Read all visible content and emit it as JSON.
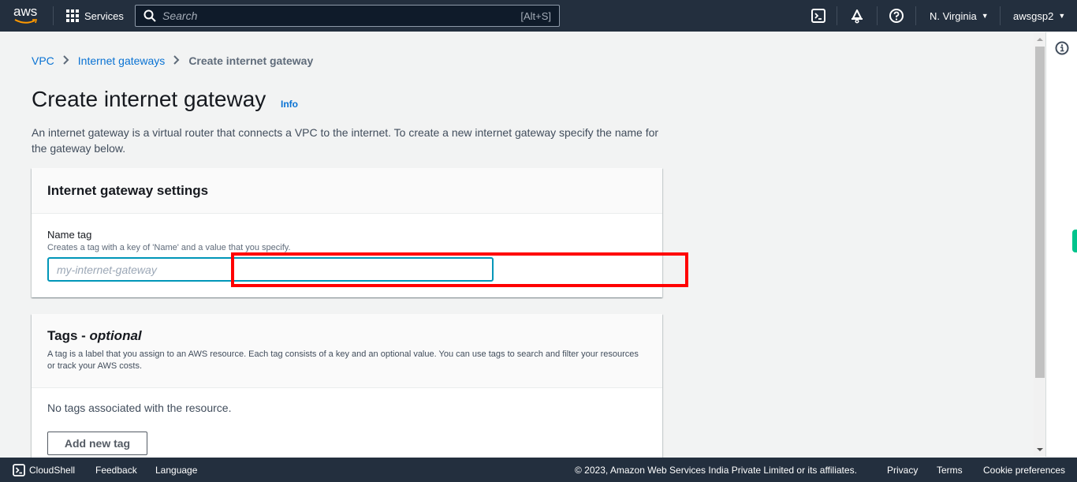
{
  "topnav": {
    "logo_text": "aws",
    "services_label": "Services",
    "search_placeholder": "Search",
    "search_shortcut": "[Alt+S]",
    "region": "N. Virginia",
    "account": "awsgsp2",
    "icons": [
      "cloudshell-icon",
      "notifications-bell-icon",
      "help-icon"
    ]
  },
  "breadcrumb": {
    "items": [
      {
        "label": "VPC",
        "link": true
      },
      {
        "label": "Internet gateways",
        "link": true
      },
      {
        "label": "Create internet gateway",
        "link": false
      }
    ],
    "separator": ">"
  },
  "page": {
    "title": "Create internet gateway",
    "info_label": "Info",
    "description": "An internet gateway is a virtual router that connects a VPC to the internet. To create a new internet gateway specify the name for the gateway below."
  },
  "settings_panel": {
    "title": "Internet gateway settings",
    "name_tag_label": "Name tag",
    "name_tag_description": "Creates a tag with a key of 'Name' and a value that you specify.",
    "name_tag_value": "",
    "name_tag_placeholder": "my-internet-gateway"
  },
  "tags_panel": {
    "title": "Tags - ",
    "title_optional": "optional",
    "description": "A tag is a label that you assign to an AWS resource. Each tag consists of a key and an optional value. You can use tags to search and filter your resources or track your AWS costs.",
    "empty_message": "No tags associated with the resource.",
    "add_button_label": "Add new tag"
  },
  "footer": {
    "cloudshell_label": "CloudShell",
    "feedback_label": "Feedback",
    "language_label": "Language",
    "copyright": "© 2023, Amazon Web Services India Private Limited or its affiliates.",
    "privacy_label": "Privacy",
    "terms_label": "Terms",
    "cookie_label": "Cookie preferences"
  },
  "colors": {
    "nav_bg": "#232f3e",
    "link": "#0972d3",
    "input_focus": "#0096b8",
    "highlight": "#ff0000",
    "aws_orange": "#ff9900"
  }
}
